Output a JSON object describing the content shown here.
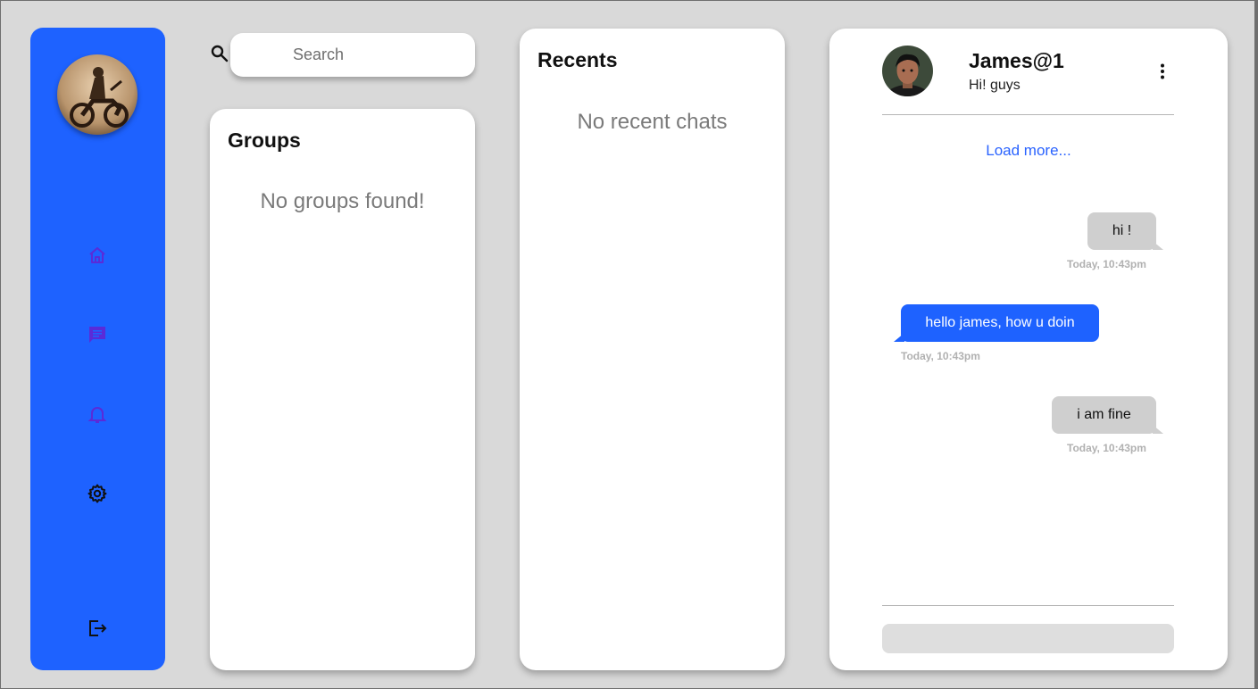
{
  "search": {
    "placeholder": "Search"
  },
  "sidebar": {
    "nav": [
      {
        "icon": "home-icon"
      },
      {
        "icon": "chat-icon"
      },
      {
        "icon": "bell-icon"
      },
      {
        "icon": "gear-icon"
      }
    ],
    "logout_icon": "logout-icon"
  },
  "groups": {
    "title": "Groups",
    "empty": "No groups found!"
  },
  "recents": {
    "title": "Recents",
    "empty": "No recent chats"
  },
  "chat": {
    "contact_name": "James@1",
    "contact_status": "Hi! guys",
    "load_more": "Load more...",
    "messages": [
      {
        "text": "hi !",
        "time": "Today, 10:43pm",
        "direction": "outgoing"
      },
      {
        "text": "hello james, how u doin",
        "time": "Today, 10:43pm",
        "direction": "incoming"
      },
      {
        "text": "i am fine",
        "time": "Today, 10:43pm",
        "direction": "outgoing"
      }
    ],
    "input_placeholder": ""
  },
  "colors": {
    "accent": "#1e62ff",
    "background": "#d9d9d9",
    "outgoing_bubble": "#cfcfcf",
    "link": "#2a63ff",
    "muted_text": "#7a7a7a"
  }
}
